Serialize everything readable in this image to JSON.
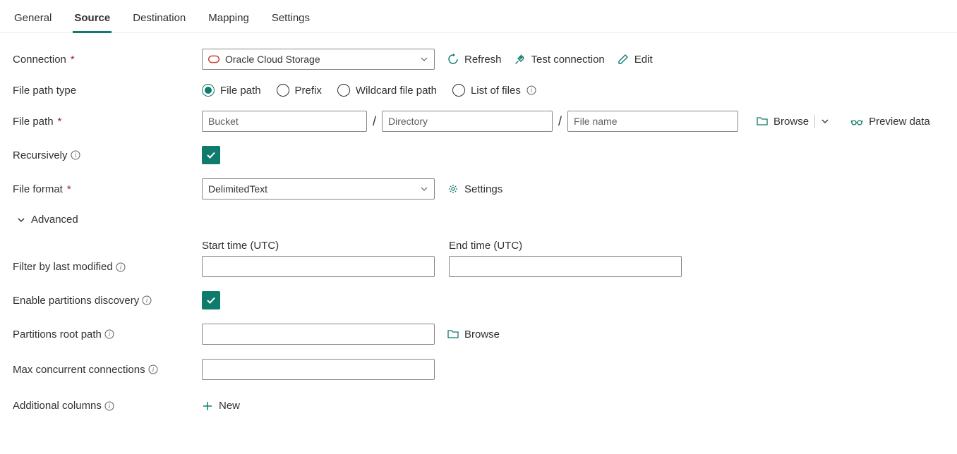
{
  "tabs": {
    "general": "General",
    "source": "Source",
    "destination": "Destination",
    "mapping": "Mapping",
    "settings": "Settings"
  },
  "labels": {
    "connection": "Connection",
    "file_path_type": "File path type",
    "file_path": "File path",
    "recursively": "Recursively",
    "file_format": "File format",
    "advanced": "Advanced",
    "start_time": "Start time (UTC)",
    "end_time": "End time (UTC)",
    "filter_by_last_modified": "Filter by last modified",
    "enable_partitions_discovery": "Enable partitions discovery",
    "partitions_root_path": "Partitions root path",
    "max_concurrent_connections": "Max concurrent connections",
    "additional_columns": "Additional columns"
  },
  "values": {
    "connection": "Oracle Cloud Storage",
    "file_format": "DelimitedText"
  },
  "placeholders": {
    "bucket": "Bucket",
    "directory": "Directory",
    "file_name": "File name"
  },
  "actions": {
    "refresh": "Refresh",
    "test_connection": "Test connection",
    "edit": "Edit",
    "settings": "Settings",
    "browse": "Browse",
    "preview_data": "Preview data",
    "new": "New"
  },
  "radios": {
    "file_path": "File path",
    "prefix": "Prefix",
    "wildcard": "Wildcard file path",
    "list_of_files": "List of files"
  }
}
